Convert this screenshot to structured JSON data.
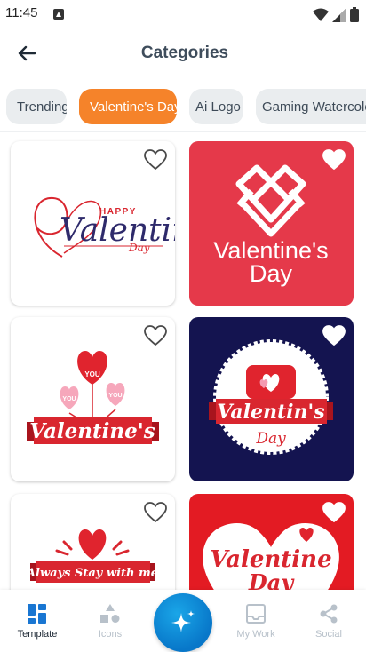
{
  "status_bar": {
    "time": "11:45"
  },
  "header": {
    "title": "Categories"
  },
  "tabs": [
    {
      "label": "Trending"
    },
    {
      "label": "Valentine's Day"
    },
    {
      "label": "Ai Logo"
    },
    {
      "label": "Gaming Watercolo"
    }
  ],
  "cards": [
    {
      "texts": [
        "HAPPY",
        "Valentine",
        "Day"
      ],
      "favorited": false
    },
    {
      "texts": [
        "Valentine's",
        "Day"
      ],
      "favorited": true
    },
    {
      "texts": [
        "YOU",
        "YOU",
        "YOU",
        "Valentine's"
      ],
      "favorited": false
    },
    {
      "texts": [
        "Valentin's",
        "Day"
      ],
      "favorited": true
    },
    {
      "texts": [
        "Always Stay with me"
      ],
      "favorited": false
    },
    {
      "texts": [
        "Valentine",
        "Day"
      ],
      "favorited": true
    }
  ],
  "bottom_nav": [
    {
      "label": "Template",
      "icon": "grid-icon"
    },
    {
      "label": "Icons",
      "icon": "shapes-icon"
    },
    {
      "label": "My Work",
      "icon": "inbox-icon"
    },
    {
      "label": "Social",
      "icon": "share-icon"
    }
  ],
  "fab": {
    "icon": "sparkle-icon"
  },
  "colors": {
    "accent": "#f5832a",
    "valentine_red": "#e5394a",
    "navy": "#141450",
    "fab_blue": "#0d8fdb"
  }
}
